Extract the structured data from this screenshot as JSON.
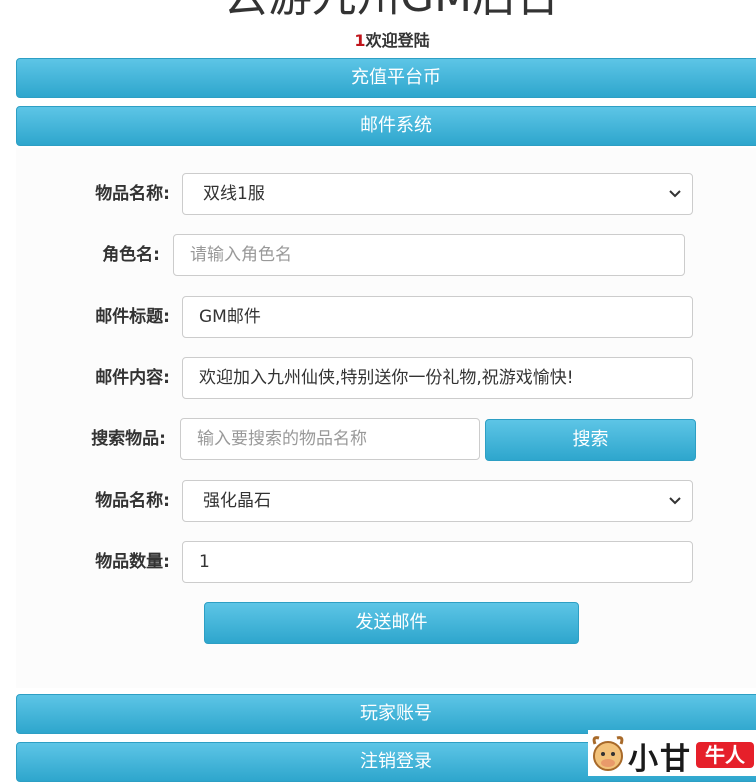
{
  "header": {
    "title": "云游九州GM后台",
    "user_id": "1",
    "welcome_text": "欢迎登陆"
  },
  "menu": {
    "recharge_label": "充值平台币",
    "mail_label": "邮件系统",
    "players_label": "玩家账号",
    "logout_label": "注销登录"
  },
  "mail_form": {
    "server_label": "物品名称:",
    "server_value": "双线1服",
    "role_label": "角色名:",
    "role_placeholder": "请输入角色名",
    "subject_label": "邮件标题:",
    "subject_value": "GM邮件",
    "content_label": "邮件内容:",
    "content_value": "欢迎加入九州仙侠,特别送你一份礼物,祝游戏愉快!",
    "search_label": "搜索物品:",
    "search_placeholder": "输入要搜索的物品名称",
    "search_button": "搜索",
    "item_label": "物品名称:",
    "item_value": "强化晶石",
    "qty_label": "物品数量:",
    "qty_value": "1",
    "send_button": "发送邮件"
  },
  "watermark": {
    "text1": "小甘",
    "text2": "牛人"
  },
  "colors": {
    "accent": "#2ea6cd",
    "accent_light": "#5dc5e6",
    "user_id": "#c0141b"
  }
}
